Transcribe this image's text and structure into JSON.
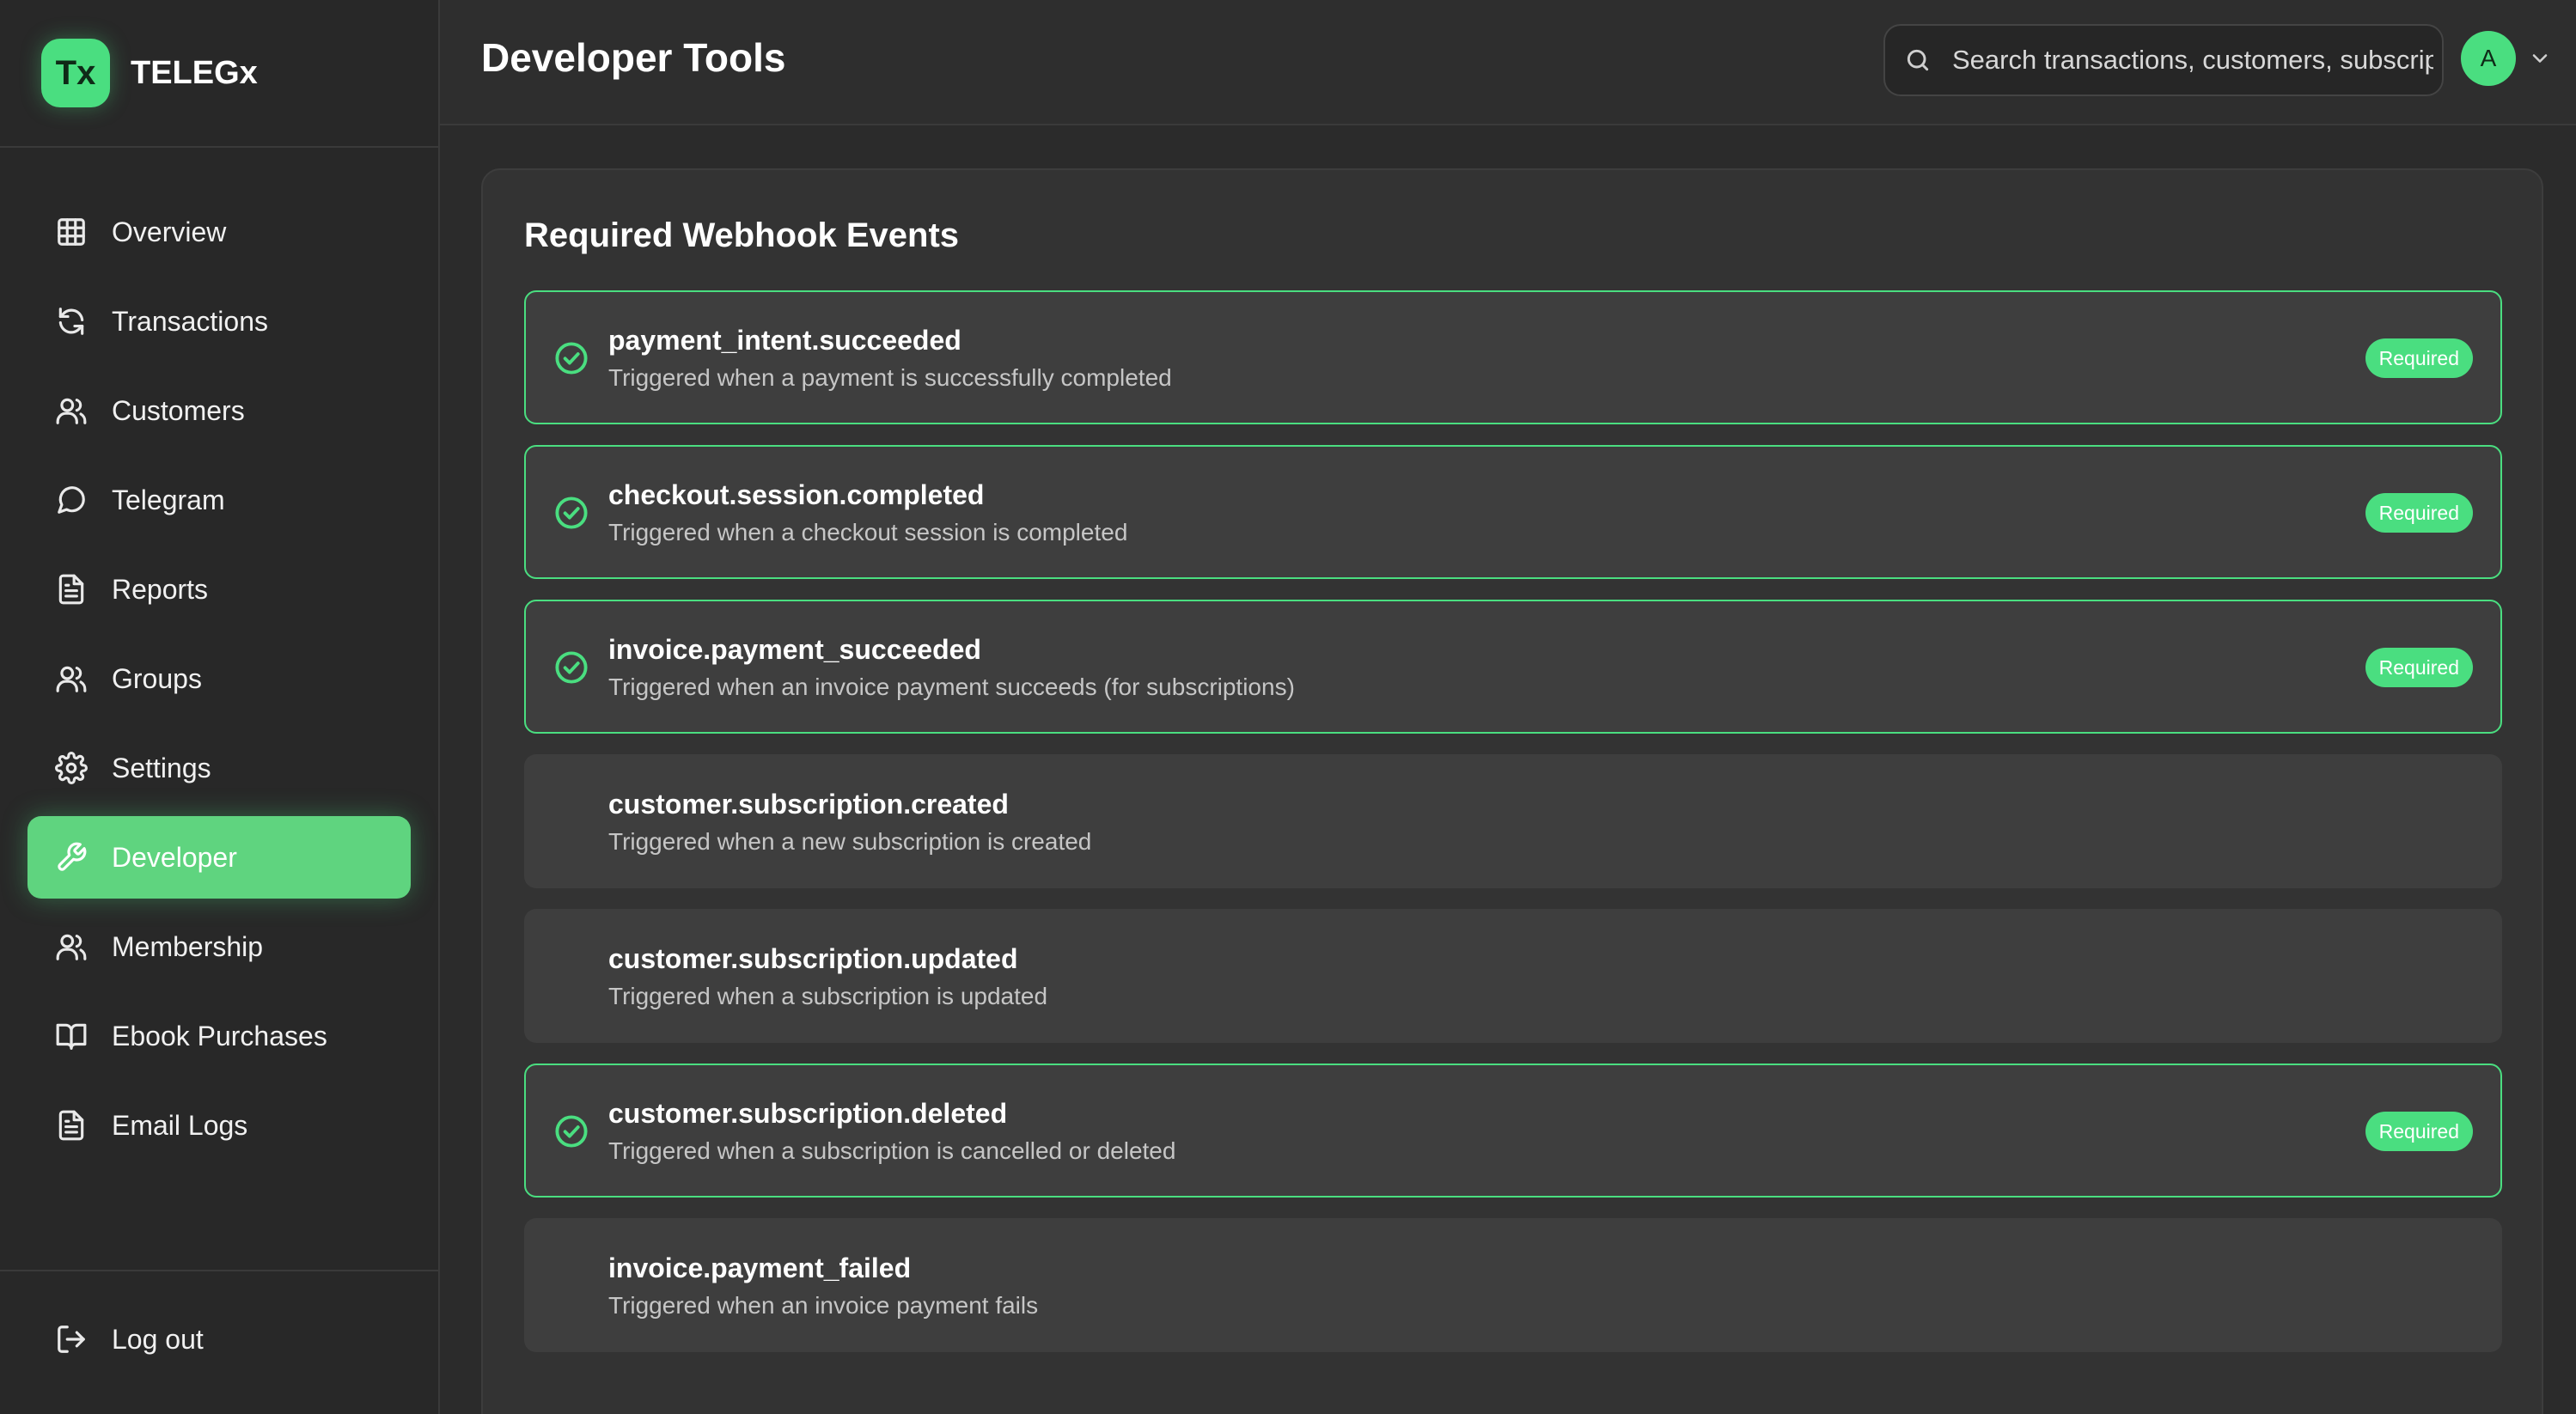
{
  "brand": {
    "logo_text": "Tx",
    "name": "TELEGx"
  },
  "sidebar": {
    "items": [
      {
        "label": "Overview",
        "icon": "grid-icon"
      },
      {
        "label": "Transactions",
        "icon": "refresh-icon"
      },
      {
        "label": "Customers",
        "icon": "users-icon"
      },
      {
        "label": "Telegram",
        "icon": "message-circle-icon"
      },
      {
        "label": "Reports",
        "icon": "file-text-icon"
      },
      {
        "label": "Groups",
        "icon": "users-icon"
      },
      {
        "label": "Settings",
        "icon": "gear-icon"
      },
      {
        "label": "Developer",
        "icon": "wrench-icon",
        "active": true
      },
      {
        "label": "Membership",
        "icon": "users-icon"
      },
      {
        "label": "Ebook Purchases",
        "icon": "book-open-icon"
      },
      {
        "label": "Email Logs",
        "icon": "file-text-icon"
      }
    ],
    "logout_label": "Log out"
  },
  "header": {
    "title": "Developer Tools",
    "search_placeholder": "Search transactions, customers, subscriptions...",
    "avatar_initial": "A"
  },
  "webhooks": {
    "title": "Required Webhook Events",
    "badge_label": "Required",
    "accent_color": "#4ade80",
    "events": [
      {
        "name": "payment_intent.succeeded",
        "description": "Triggered when a payment is successfully completed",
        "required": true
      },
      {
        "name": "checkout.session.completed",
        "description": "Triggered when a checkout session is completed",
        "required": true
      },
      {
        "name": "invoice.payment_succeeded",
        "description": "Triggered when an invoice payment succeeds (for subscriptions)",
        "required": true
      },
      {
        "name": "customer.subscription.created",
        "description": "Triggered when a new subscription is created",
        "required": false
      },
      {
        "name": "customer.subscription.updated",
        "description": "Triggered when a subscription is updated",
        "required": false
      },
      {
        "name": "customer.subscription.deleted",
        "description": "Triggered when a subscription is cancelled or deleted",
        "required": true
      },
      {
        "name": "invoice.payment_failed",
        "description": "Triggered when an invoice payment fails",
        "required": false
      }
    ]
  }
}
